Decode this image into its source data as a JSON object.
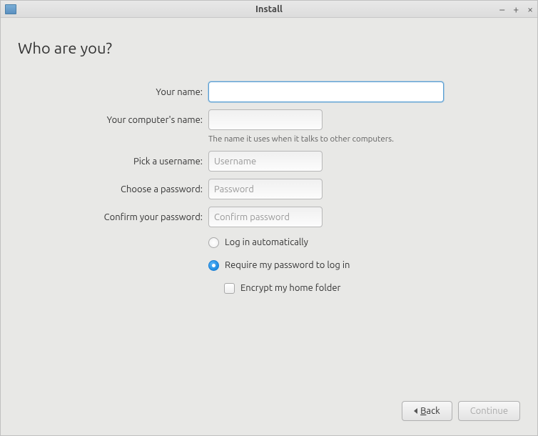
{
  "window": {
    "title": "Install"
  },
  "heading": "Who are you?",
  "labels": {
    "name": "Your name:",
    "computer": "Your computer's name:",
    "username": "Pick a username:",
    "password": "Choose a password:",
    "confirm": "Confirm your password:"
  },
  "hints": {
    "computer": "The name it uses when it talks to other computers."
  },
  "placeholders": {
    "username": "Username",
    "password": "Password",
    "confirm": "Confirm password"
  },
  "values": {
    "name": "",
    "computer": "",
    "username": "",
    "password": "",
    "confirm": ""
  },
  "options": {
    "auto_login": "Log in automatically",
    "require_password": "Require my password to log in",
    "encrypt_home": "Encrypt my home folder",
    "selected": "require_password",
    "encrypt_checked": false
  },
  "buttons": {
    "back": "Back",
    "continue": "Continue"
  }
}
